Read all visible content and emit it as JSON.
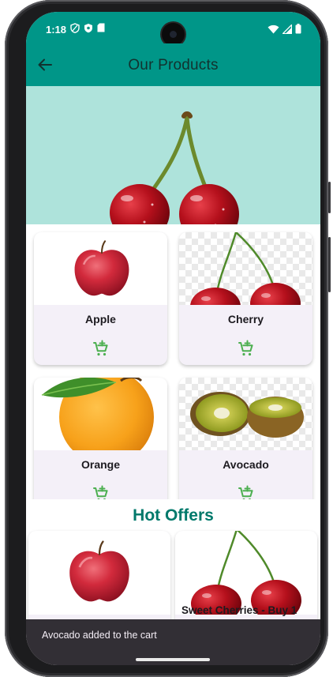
{
  "status_bar": {
    "time": "1:18",
    "left_icons": [
      "privacy-shield-icon",
      "vpn-shield-icon",
      "sd-card-icon"
    ],
    "right_icons": [
      "wifi-icon",
      "cellular-signal-icon",
      "battery-icon"
    ]
  },
  "app_bar": {
    "title": "Our Products",
    "back_icon": "arrow-back-icon"
  },
  "products": [
    {
      "name": "Apple",
      "image": "apple",
      "action_icon": "add-shopping-cart-icon"
    },
    {
      "name": "Cherry",
      "image": "cherry",
      "action_icon": "add-shopping-cart-icon"
    },
    {
      "name": "Orange",
      "image": "orange",
      "action_icon": "add-shopping-cart-icon"
    },
    {
      "name": "Avocado",
      "image": "kiwi",
      "action_icon": "add-shopping-cart-icon"
    }
  ],
  "hot_offers": {
    "title": "Hot Offers",
    "items": [
      {
        "label": "",
        "image": "apple"
      },
      {
        "label": "Sweet Cherries - Buy 1",
        "image": "cherry"
      }
    ]
  },
  "snackbar": {
    "message": "Avocado added to the cart"
  },
  "colors": {
    "primary": "#009688",
    "accent_green": "#4caf50",
    "offers_title": "#00796b",
    "card_bg": "#f4f0f8",
    "snackbar_bg": "#322f35"
  }
}
